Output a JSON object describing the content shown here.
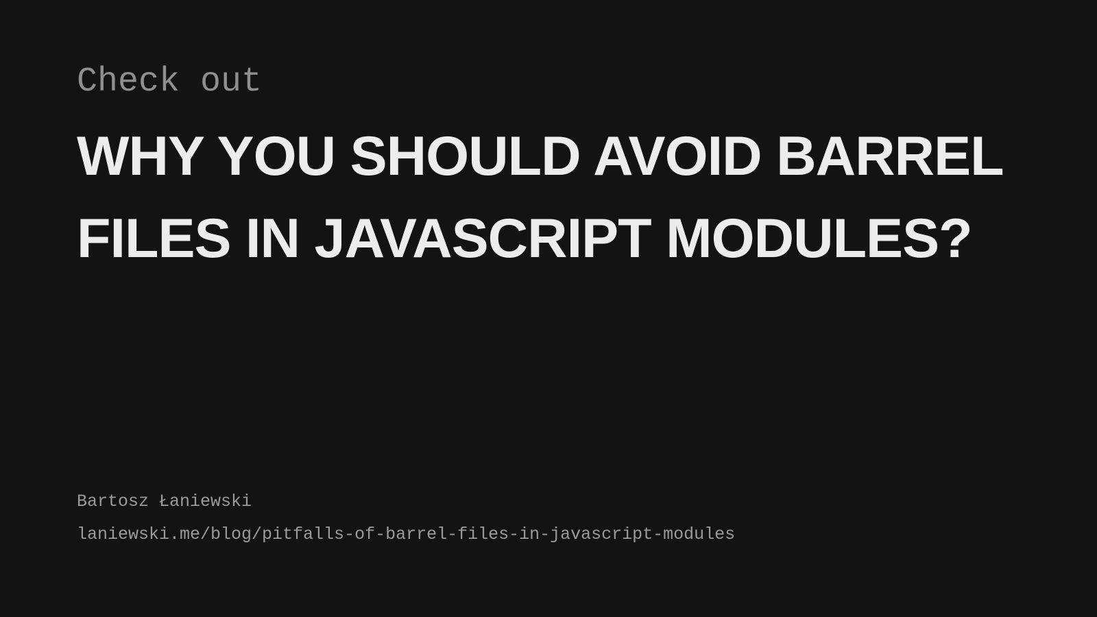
{
  "card": {
    "kicker": "Check out",
    "title_line_1": "WHY YOU SHOULD AVOID BARREL",
    "title_line_2": "FILES IN JAVASCRIPT MODULES?",
    "author": "Bartosz Łaniewski",
    "url": "laniewski.me/blog/pitfalls-of-barrel-files-in-javascript-modules"
  },
  "colors": {
    "background": "#131313",
    "title": "#ececec",
    "muted": "#8f8f8f"
  }
}
